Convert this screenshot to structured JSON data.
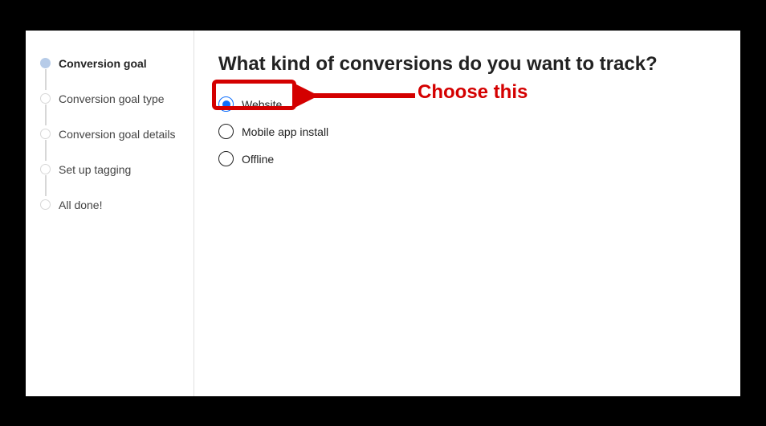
{
  "sidebar": {
    "steps": [
      {
        "label": "Conversion goal",
        "active": true
      },
      {
        "label": "Conversion goal type",
        "active": false
      },
      {
        "label": "Conversion goal details",
        "active": false
      },
      {
        "label": "Set up tagging",
        "active": false
      },
      {
        "label": "All done!",
        "active": false
      }
    ]
  },
  "main": {
    "heading": "What kind of conversions do you want to track?",
    "options": [
      {
        "label": "Website",
        "selected": true
      },
      {
        "label": "Mobile app install",
        "selected": false
      },
      {
        "label": "Offline",
        "selected": false
      }
    ]
  },
  "annotation": {
    "text": "Choose this"
  }
}
